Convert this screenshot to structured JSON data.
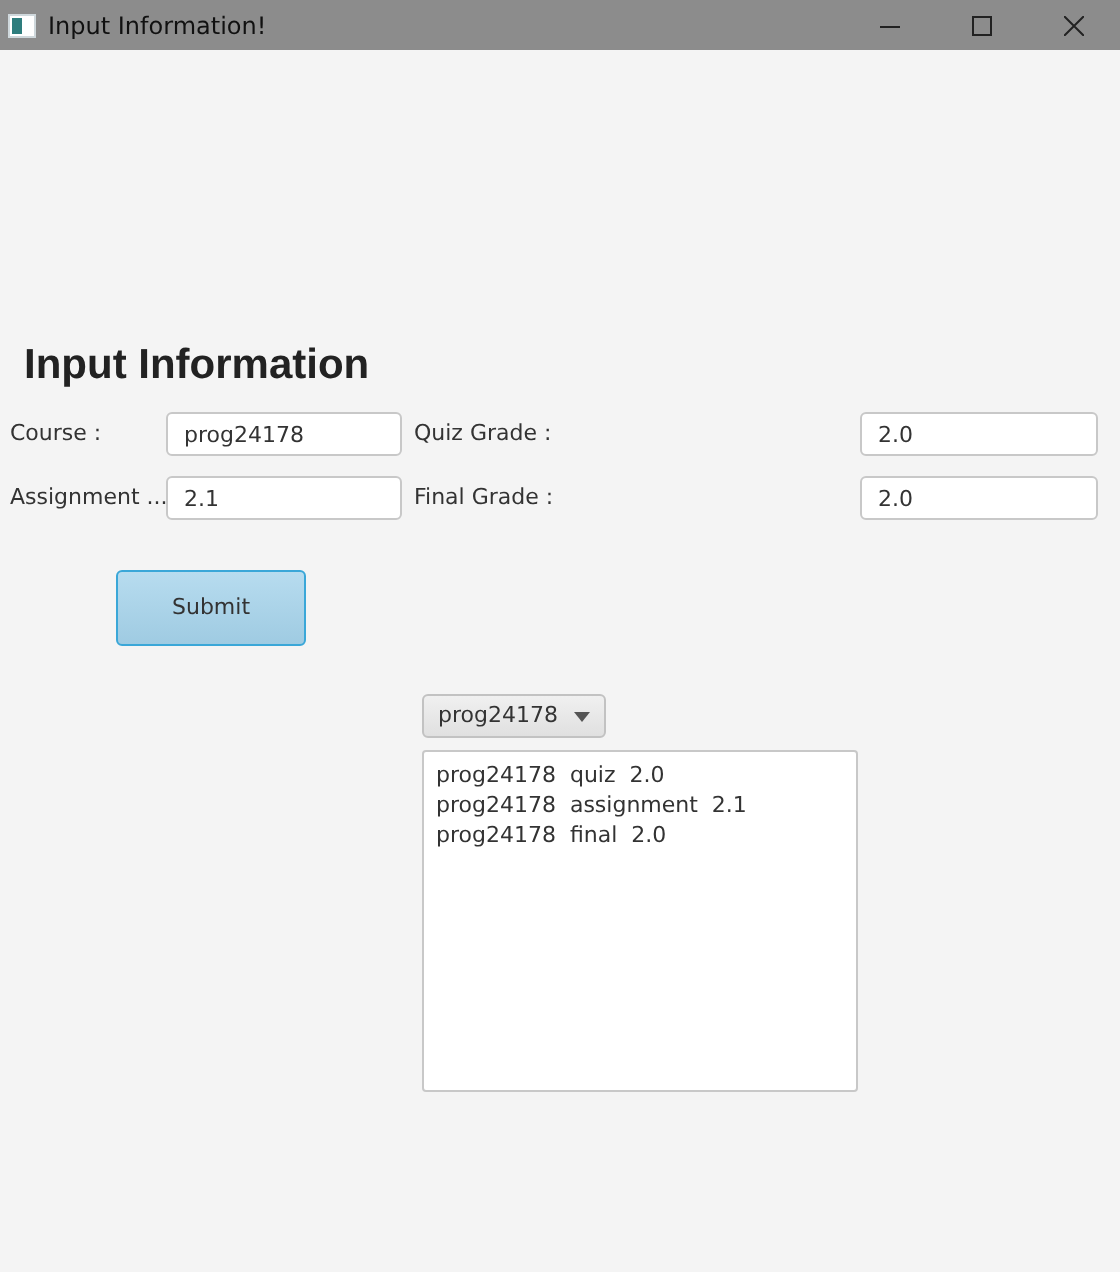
{
  "window": {
    "title": "Input Information!"
  },
  "heading": "Input Information",
  "form": {
    "rows": [
      {
        "label": "Course :",
        "value": "prog24178",
        "label_2": "Quiz Grade :",
        "value_2": "2.0"
      },
      {
        "label": "Assignment ...",
        "value": "2.1",
        "label_2": "Final Grade :",
        "value_2": "2.0"
      }
    ]
  },
  "submit_button": "Submit",
  "course_dropdown": {
    "value": "prog24178"
  },
  "output_lines": [
    "prog24178  quiz  2.0",
    "prog24178  assignment  2.1",
    "prog24178  final  2.0"
  ]
}
